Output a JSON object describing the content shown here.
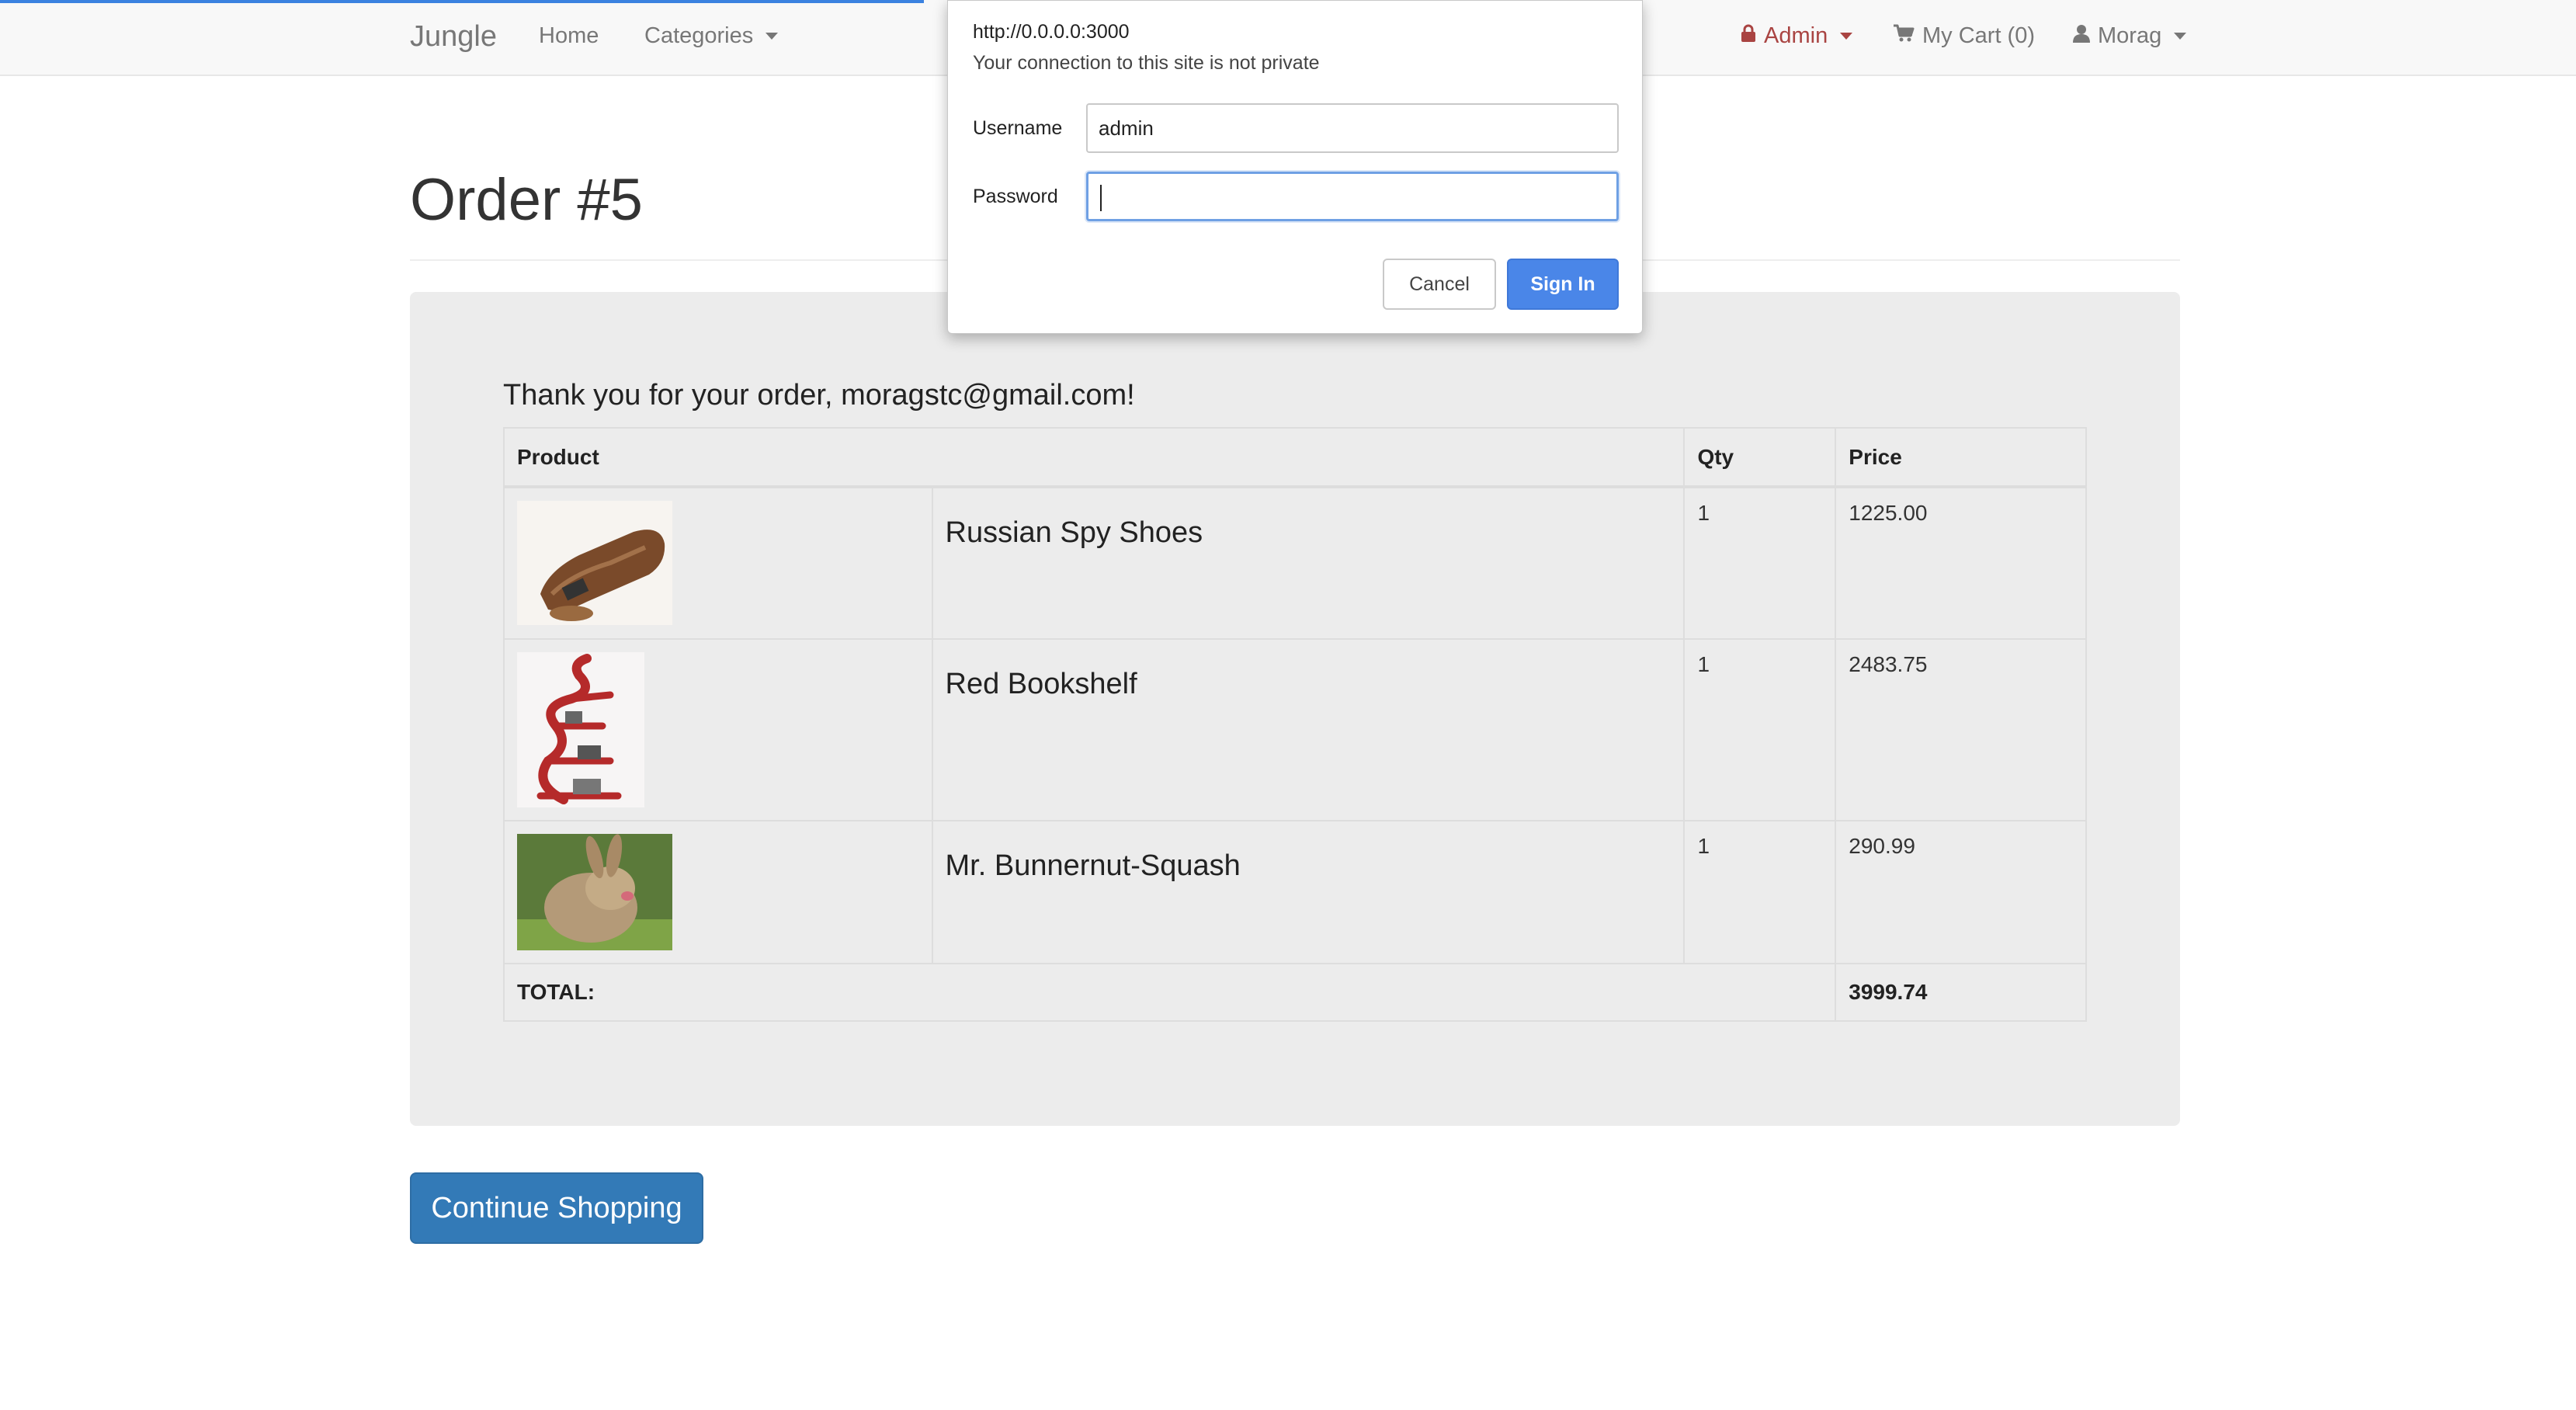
{
  "navbar": {
    "brand": "Jungle",
    "home": "Home",
    "categories": "Categories",
    "admin": "Admin",
    "cart": "My Cart (0)",
    "user": "Morag"
  },
  "page": {
    "title": "Order #5",
    "thanks": "Thank you for your order, moragstc@gmail.com!"
  },
  "table": {
    "headers": [
      "Product",
      "Qty",
      "Price"
    ],
    "rows": [
      {
        "name": "Russian Spy Shoes",
        "qty": "1",
        "price": "1225.00",
        "image": "shoe-image"
      },
      {
        "name": "Red Bookshelf",
        "qty": "1",
        "price": "2483.75",
        "image": "bookshelf-image"
      },
      {
        "name": "Mr. Bunnernut-Squash",
        "qty": "1",
        "price": "290.99",
        "image": "rabbit-image"
      }
    ],
    "total_label": "TOTAL:",
    "total_value": "3999.74"
  },
  "continue_button": "Continue Shopping",
  "auth_dialog": {
    "url": "http://0.0.0.0:3000",
    "subtitle": "Your connection to this site is not private",
    "username_label": "Username",
    "username_value": "admin",
    "password_label": "Password",
    "password_value": "",
    "cancel": "Cancel",
    "sign_in": "Sign In"
  },
  "colors": {
    "accent": "#337ab7",
    "admin": "#a94442",
    "dialog_button": "#4a86e8",
    "progress": "#3b82e0"
  },
  "icons": [
    "lock-icon",
    "cart-icon",
    "user-icon",
    "caret-down-icon"
  ]
}
